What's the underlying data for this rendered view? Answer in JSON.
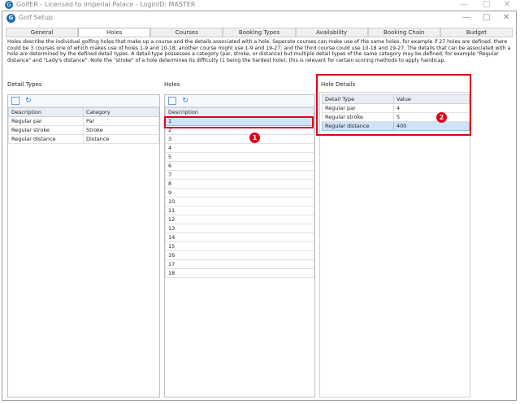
{
  "outer_window": {
    "title": "GolfER - Licensed to Imperial Palace - LoginID: MASTER",
    "minimize": "—",
    "maximize": "□",
    "close": "✕"
  },
  "window": {
    "title": "Golf Setup",
    "minimize": "—",
    "maximize": "□",
    "close": "✕",
    "logo_letter": "G"
  },
  "tabs": [
    {
      "label": "General"
    },
    {
      "label": "Holes"
    },
    {
      "label": "Courses"
    },
    {
      "label": "Booking Types"
    },
    {
      "label": "Availability"
    },
    {
      "label": "Booking Chain"
    },
    {
      "label": "Budget"
    }
  ],
  "description": "Holes describe the individual golfing holes that make up a course and the details associated with a hole. Seperate courses can make use of the same holes, for example if 27 holes are defined, there could be 3 courses one of which makes use of holes 1-9 and 10-18; another course might use 1-9 and 19-27; and the third course could use 10-18 and 19-27. The details that can be associated with a hole are determined by the defined detail types. A detail type possesses a category (par, stroke, or distance) but multiple detail types of the same category may be defined; for example \"Regular distance\" and \"Lady's distance\". Note the \"stroke\" of a hole determines its difficulty (1 being the hardest hole); this is relevant for certain scoring methods to apply handicap.",
  "detail_types": {
    "label": "Detail Types",
    "columns": [
      "Description",
      "Category"
    ],
    "rows": [
      [
        "Regular par",
        "Par"
      ],
      [
        "Regular stroke",
        "Stroke"
      ],
      [
        "Regular distance",
        "Distance"
      ]
    ]
  },
  "holes": {
    "label": "Holes",
    "column": "Description",
    "rows": [
      "1",
      "2",
      "3",
      "4",
      "5",
      "6",
      "7",
      "8",
      "9",
      "10",
      "11",
      "12",
      "13",
      "14",
      "15",
      "16",
      "17",
      "18"
    ],
    "selected_index": 0
  },
  "hole_details": {
    "label": "Hole Details",
    "columns": [
      "Detail Type",
      "Value"
    ],
    "rows": [
      [
        "Regular par",
        "4"
      ],
      [
        "Regular stroke",
        "5"
      ],
      [
        "Regular distance",
        "400"
      ]
    ],
    "selected_index": 2
  },
  "annotations": {
    "badge_1": "1",
    "badge_2": "2",
    "highlight_color": "#e2001a"
  },
  "colors": {
    "accent": "#1e6bb8",
    "selection": "#cfe2f7"
  }
}
